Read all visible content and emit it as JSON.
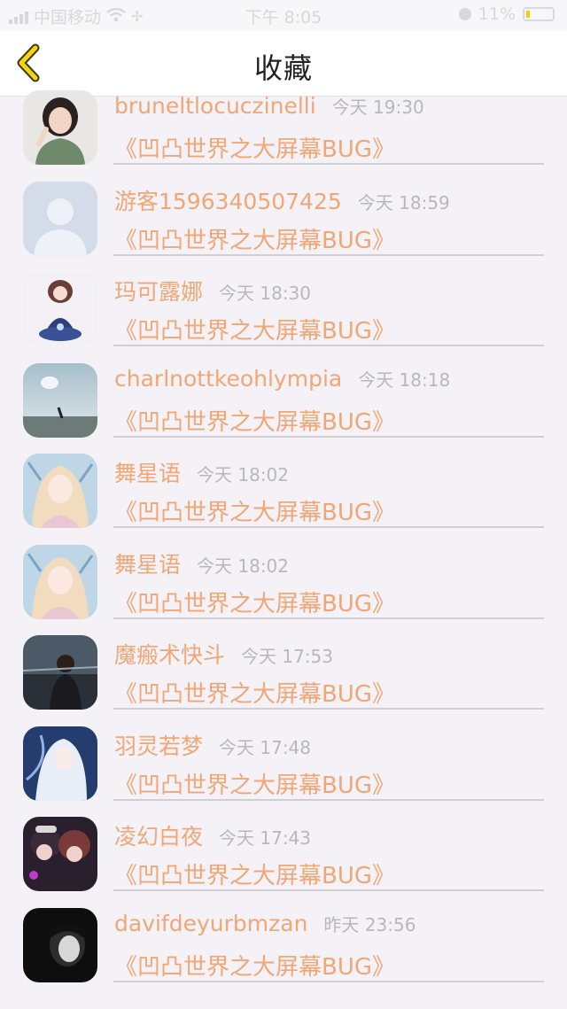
{
  "status_bar": {
    "carrier": "中国移动",
    "time": "下午 8:05",
    "battery": "11%"
  },
  "nav": {
    "title": "收藏"
  },
  "favorites": [
    {
      "user": "bruneltlocuczinelli",
      "time": "今天 19:30",
      "title": "《凹凸世界之大屏幕BUG》",
      "avatar": "photo-girl"
    },
    {
      "user": "游客1596340507425",
      "time": "今天 18:59",
      "title": "《凹凸世界之大屏幕BUG》",
      "avatar": "default"
    },
    {
      "user": "玛可露娜",
      "time": "今天 18:30",
      "title": "《凹凸世界之大屏幕BUG》",
      "avatar": "anime-blue-dress"
    },
    {
      "user": "charlnottkeohlympia",
      "time": "今天 18:18",
      "title": "《凹凸世界之大屏幕BUG》",
      "avatar": "sky-landscape"
    },
    {
      "user": "舞星语",
      "time": "今天 18:02",
      "title": "《凹凸世界之大屏幕BUG》",
      "avatar": "anime-blonde"
    },
    {
      "user": "舞星语",
      "time": "今天 18:02",
      "title": "《凹凸世界之大屏幕BUG》",
      "avatar": "anime-blonde"
    },
    {
      "user": "魔瘢术快斗",
      "time": "今天 17:53",
      "title": "《凹凸世界之大屏幕BUG》",
      "avatar": "dark-city"
    },
    {
      "user": "羽灵若梦",
      "time": "今天 17:48",
      "title": "《凹凸世界之大屏幕BUG》",
      "avatar": "anime-white"
    },
    {
      "user": "凌幻白夜",
      "time": "今天 17:43",
      "title": "《凹凸世界之大屏幕BUG》",
      "avatar": "anime-duo"
    },
    {
      "user": "davifdeyurbmzan",
      "time": "昨天 23:56",
      "title": "《凹凸世界之大屏幕BUG》",
      "avatar": "dark-portrait"
    }
  ]
}
